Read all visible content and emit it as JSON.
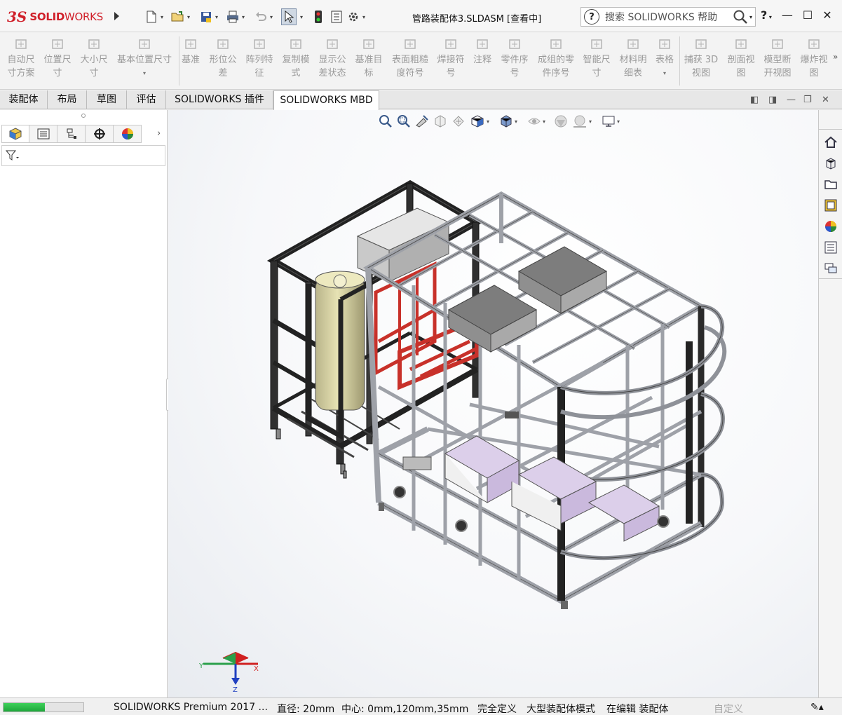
{
  "app": {
    "logo_ds": "3S",
    "logo_solid": "SOLID",
    "logo_works": "WORKS",
    "document_title": "管路装配体3.SLDASM [查看中]",
    "search_placeholder": "搜索 SOLIDWORKS 帮助",
    "help_label": "?"
  },
  "ribbon": {
    "buttons": [
      {
        "label": "自动尺\n寸方案"
      },
      {
        "label": "位置尺\n寸"
      },
      {
        "label": "大小尺\n寸"
      },
      {
        "label": "基本位置尺寸"
      },
      {
        "label": "基准"
      },
      {
        "label": "形位公\n差"
      },
      {
        "label": "阵列特\n征"
      },
      {
        "label": "复制模\n式"
      },
      {
        "label": "显示公\n差状态"
      },
      {
        "label": "基准目\n标"
      },
      {
        "label": "表面粗糙\n度符号"
      },
      {
        "label": "焊接符\n号"
      },
      {
        "label": "注释"
      },
      {
        "label": "零件序\n号"
      },
      {
        "label": "成组的零\n件序号"
      },
      {
        "label": "智能尺\n寸"
      },
      {
        "label": "材料明\n细表"
      },
      {
        "label": "表格"
      },
      {
        "label": "捕获 3D\n视图"
      },
      {
        "label": "剖面视\n图"
      },
      {
        "label": "模型断\n开视图"
      },
      {
        "label": "爆炸视\n图"
      }
    ]
  },
  "tabs": [
    "装配体",
    "布局",
    "草图",
    "评估",
    "SOLIDWORKS 插件",
    "SOLIDWORKS MBD"
  ],
  "active_tab": "SOLIDWORKS MBD",
  "triad": {
    "x": "X",
    "y": "Y",
    "z": "Z"
  },
  "status": {
    "progress_percent": 52,
    "product": "SOLIDWORKS Premium 2017 ...",
    "diameter": "直径: 20mm",
    "center": "中心: 0mm,120mm,35mm",
    "definition": "完全定义",
    "mode": "大型装配体模式",
    "editing": "在编辑 装配体",
    "custom": "自定义"
  },
  "colors": {
    "brand_red": "#d0202a",
    "frame_silver": "#b8bcc4",
    "frame_black": "#2b2b2b",
    "red_structure": "#c8312a",
    "tank_yellow": "#d8d294",
    "panel_pink": "#d9cde6"
  }
}
